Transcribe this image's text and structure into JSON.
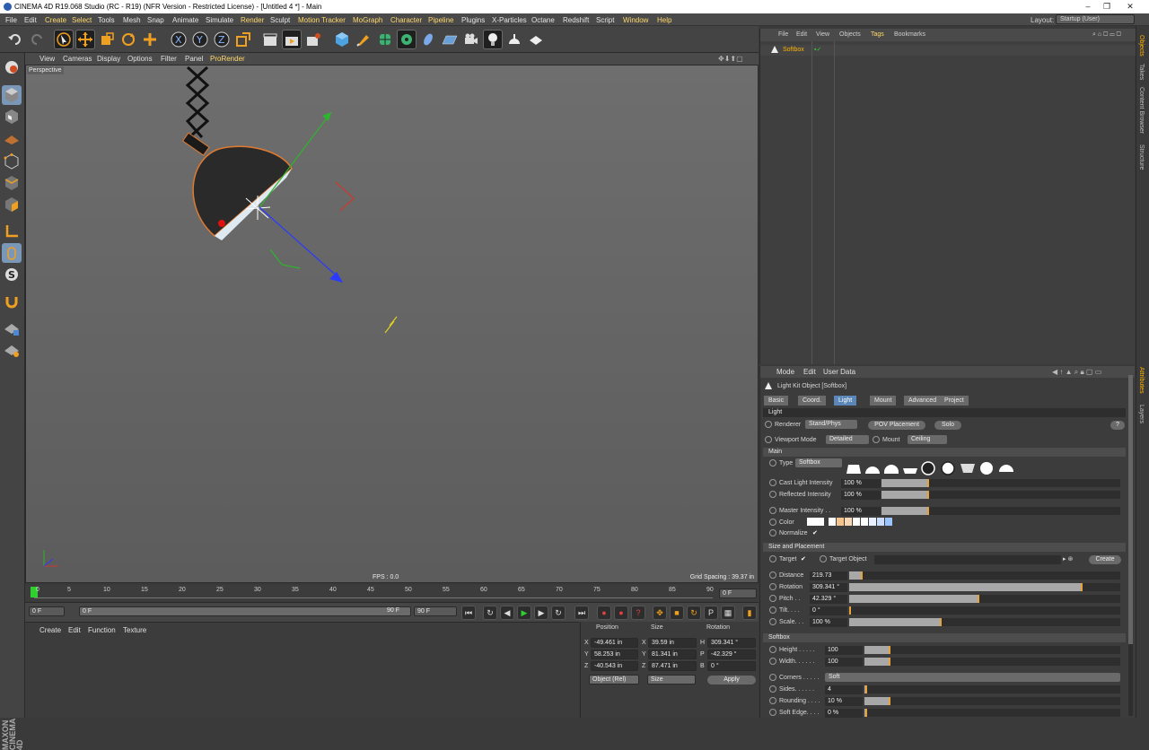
{
  "window": {
    "title": "CINEMA 4D R19.068 Studio (RC - R19) (NFR Version - Restricted License) - [Untitled 4 *] - Main",
    "min": "–",
    "max": "❐",
    "close": "✕"
  },
  "menu": [
    {
      "label": "File",
      "hl": false
    },
    {
      "label": "Edit",
      "hl": false
    },
    {
      "label": "Create",
      "hl": true
    },
    {
      "label": "Select",
      "hl": true
    },
    {
      "label": "Tools",
      "hl": false
    },
    {
      "label": "Mesh",
      "hl": false
    },
    {
      "label": "Snap",
      "hl": false
    },
    {
      "label": "Animate",
      "hl": false
    },
    {
      "label": "Simulate",
      "hl": false
    },
    {
      "label": "Render",
      "hl": true
    },
    {
      "label": "Sculpt",
      "hl": false
    },
    {
      "label": "Motion Tracker",
      "hl": true
    },
    {
      "label": "MoGraph",
      "hl": true
    },
    {
      "label": "Character",
      "hl": true
    },
    {
      "label": "Pipeline",
      "hl": true
    },
    {
      "label": "Plugins",
      "hl": false
    },
    {
      "label": "X-Particles",
      "hl": false
    },
    {
      "label": "Octane",
      "hl": false
    },
    {
      "label": "Redshift",
      "hl": false
    },
    {
      "label": "Script",
      "hl": false
    },
    {
      "label": "Window",
      "hl": true
    },
    {
      "label": "Help",
      "hl": true
    }
  ],
  "layout": {
    "label": "Layout:",
    "value": "Startup (User)"
  },
  "viewport": {
    "menu": [
      "View",
      "Cameras",
      "Display",
      "Options",
      "Filter",
      "Panel",
      "ProRender"
    ],
    "label": "Perspective",
    "fps": "FPS : 0.0",
    "grid": "Grid Spacing : 39.37 in"
  },
  "timeline": {
    "ticks": [
      "0",
      "5",
      "10",
      "15",
      "20",
      "25",
      "30",
      "35",
      "40",
      "45",
      "50",
      "55",
      "60",
      "65",
      "70",
      "75",
      "80",
      "85",
      "90"
    ],
    "end_frame": "0 F",
    "start": "0 F",
    "mid": "0 F",
    "range_end": "90 F",
    "max": "90 F"
  },
  "material": {
    "menu": [
      "Create",
      "Edit",
      "Function",
      "Texture"
    ]
  },
  "coords": {
    "headers": [
      "Position",
      "Size",
      "Rotation"
    ],
    "rows": [
      {
        "axis": "X",
        "pos": "-49.461 in",
        "saxis": "X",
        "size": "39.59 in",
        "raxis": "H",
        "rot": "309.341 °"
      },
      {
        "axis": "Y",
        "pos": "58.253 in",
        "saxis": "Y",
        "size": "81.341 in",
        "raxis": "P",
        "rot": "-42.329 °"
      },
      {
        "axis": "Z",
        "pos": "-40.543 in",
        "saxis": "Z",
        "size": "87.471 in",
        "raxis": "B",
        "rot": "0 °"
      }
    ],
    "mode": "Object (Rel)",
    "size_mode": "Size",
    "apply": "Apply"
  },
  "objects": {
    "menu": [
      "File",
      "Edit",
      "View",
      "Objects",
      "Tags",
      "Bookmarks"
    ],
    "items": [
      {
        "name": "Softbox"
      }
    ]
  },
  "attributes": {
    "menu": [
      "Mode",
      "Edit",
      "User Data"
    ],
    "object": "Light Kit Object [Softbox]",
    "tabs": [
      {
        "label": "Basic",
        "active": false
      },
      {
        "label": "Coord.",
        "active": false
      },
      {
        "label": "Light",
        "active": true
      },
      {
        "label": "Mount",
        "active": false
      },
      {
        "label": "Advanced",
        "active": false
      },
      {
        "label": "Project",
        "active": false
      }
    ],
    "section_light": "Light",
    "renderer_label": "Renderer",
    "renderer": "Stand/Phys",
    "pov": "POV Placement",
    "solo": "Solo",
    "help": "?",
    "viewport_mode_label": "Viewport Mode",
    "viewport_mode": "Detailed",
    "mount_label": "Mount",
    "mount": "Ceiling",
    "main": "Main",
    "type_label": "Type",
    "type": "Softbox",
    "cast": {
      "label": "Cast Light Intensity",
      "value": "100 %",
      "fill": 0.2
    },
    "reflected": {
      "label": "Reflected Intensity",
      "value": "100 %",
      "fill": 0.2
    },
    "master": {
      "label": "Master Intensity . .",
      "value": "100 %",
      "fill": 0.2
    },
    "color_label": "Color",
    "normalize_label": "Normalize",
    "swatch_colors": [
      "#ffffff",
      "#f4c48e",
      "#f9d7b3",
      "#ffffff",
      "#ffffff",
      "#e8f0ff",
      "#c9dcff",
      "#9cc4ff"
    ],
    "size_section": "Size and Placement",
    "target_label": "Target",
    "target_object_label": "Target Object",
    "create": "Create",
    "distance": {
      "label": "Distance",
      "value": "219.73",
      "fill": 0.05
    },
    "rotation": {
      "label": "Rotation",
      "value": "309.341 °",
      "fill": 0.86
    },
    "pitch": {
      "label": "Pitch . .",
      "value": "42.329 °",
      "fill": 0.48
    },
    "tilt": {
      "label": "Tilt. . . .",
      "value": "0 °",
      "fill": 0
    },
    "scale": {
      "label": "Scale. . .",
      "value": "100 %",
      "fill": 0.34
    },
    "softbox_section": "Softbox",
    "height": {
      "label": "Height . . . . .",
      "value": "100",
      "fill": 0.1
    },
    "width": {
      "label": "Width. . . . . .",
      "value": "100",
      "fill": 0.1
    },
    "corners": {
      "label": "Corners . . . . .",
      "value": "Soft"
    },
    "sides": {
      "label": "Sides. . . . . .",
      "value": "4",
      "fill": 0.01
    },
    "rounding": {
      "label": "Rounding . . . .",
      "value": "10 %",
      "fill": 0.1
    },
    "softedge": {
      "label": "Soft Edge. . . .",
      "value": "0 %",
      "fill": 0.01
    }
  },
  "side_tabs": [
    "Objects",
    "Takes",
    "Content Browser",
    "Structure"
  ],
  "side_tabs2": [
    "Attributes",
    "Layers"
  ],
  "brand": [
    "MAXON",
    "CINEMA 4D"
  ]
}
